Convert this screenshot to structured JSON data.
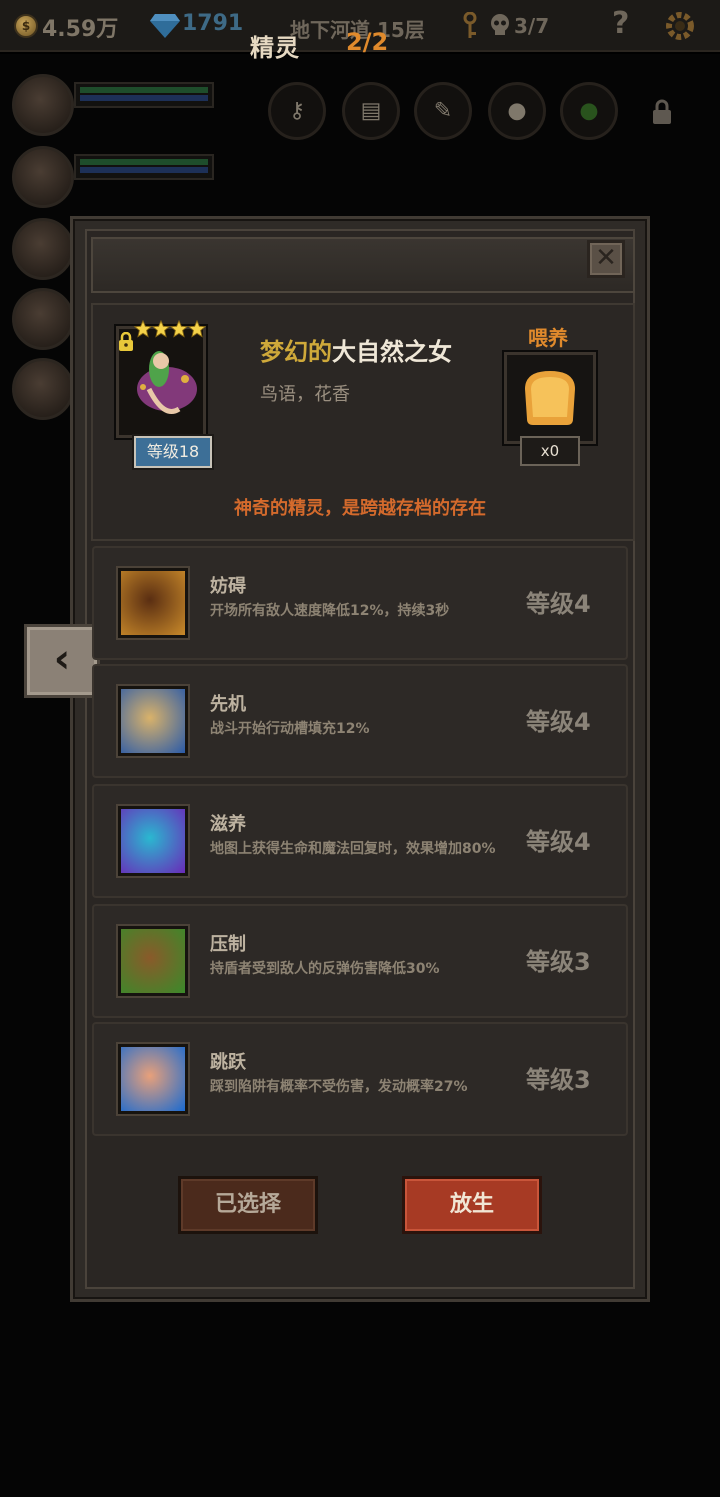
{
  "hud": {
    "gold": "4.59万",
    "coin_symbol": "$",
    "gems": "1791",
    "floor": "地下河道 15层",
    "skull_count": "3/7",
    "help": "?"
  },
  "panel": {
    "title": "精灵",
    "count": "2/2",
    "close": "✕"
  },
  "character": {
    "name_adj": "梦幻的",
    "name_noun": "大自然之女",
    "description": "鸟语，花香",
    "level": "等级18",
    "stars": 4,
    "feed_label": "喂养",
    "feed_count": "x0",
    "tagline": "神奇的精灵，是跨越存档的存在"
  },
  "skills": [
    {
      "name": "妨碍",
      "desc": "开场所有敌人速度降低12%，持续3秒",
      "level": "等级4",
      "icon": "chained-boot-icon"
    },
    {
      "name": "先机",
      "desc": "战斗开始行动槽填充12%",
      "level": "等级4",
      "icon": "leopard-icon"
    },
    {
      "name": "滋养",
      "desc": "地图上获得生命和魔法回复时，效果增加80%",
      "level": "等级4",
      "icon": "butterfly-wings-icon"
    },
    {
      "name": "压制",
      "desc": "持盾者受到敌人的反弹伤害降低30%",
      "level": "等级3",
      "icon": "beast-claw-icon"
    },
    {
      "name": "跳跃",
      "desc": "踩到陷阱有概率不受伤害，发动概率27%",
      "level": "等级3",
      "icon": "leaping-leg-icon"
    }
  ],
  "buttons": {
    "selected": "已选择",
    "release": "放生"
  },
  "nav": {
    "side_arrow": "‹"
  },
  "colors": {
    "accent_orange": "#e08a2c",
    "name_gold": "#cfa93a",
    "tagline": "#d46a2c",
    "release_button": "#a73a24"
  }
}
